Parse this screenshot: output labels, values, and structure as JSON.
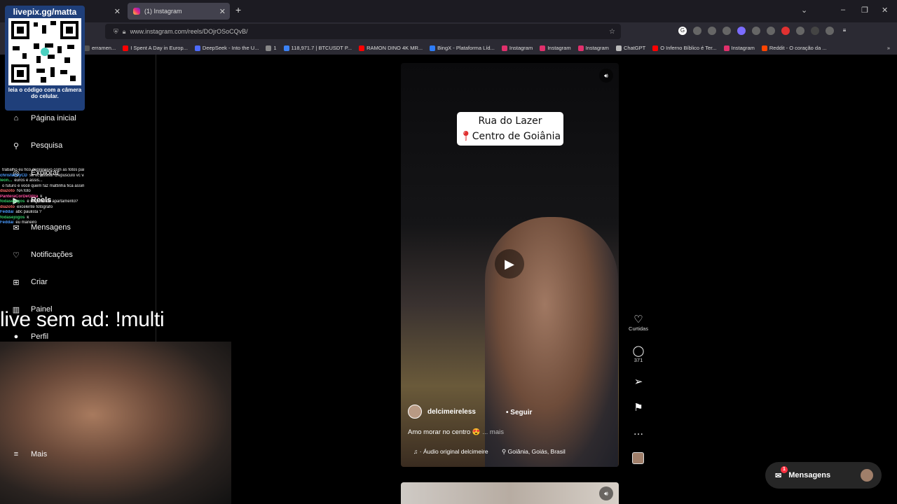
{
  "browser": {
    "tabs": [
      {
        "label": "",
        "active": false
      },
      {
        "label": "(1) Instagram",
        "active": true
      }
    ],
    "url": "www.instagram.com/reels/DOjrOSoCQvB/",
    "bookmarks": [
      {
        "label": "erramen...",
        "color": "#555555"
      },
      {
        "label": "I Spent A Day in Europ...",
        "color": "#ff0000"
      },
      {
        "label": "DeepSeek - Into the U...",
        "color": "#4d6bfe"
      },
      {
        "label": "1",
        "color": "#888888"
      },
      {
        "label": "118,971.7 | BTCUSDT P...",
        "color": "#3b82f6"
      },
      {
        "label": "RAMON DINO 4K MR...",
        "color": "#ff0000"
      },
      {
        "label": "BingX - Plataforma Líd...",
        "color": "#2e7cf6"
      },
      {
        "label": "Instagram",
        "color": "#e1306c"
      },
      {
        "label": "Instagram",
        "color": "#e1306c"
      },
      {
        "label": "Instagram",
        "color": "#e1306c"
      },
      {
        "label": "ChatGPT",
        "color": "#bbbbbb"
      },
      {
        "label": "O Inferno Bíblico é Ter...",
        "color": "#ff0000"
      },
      {
        "label": "Instagram",
        "color": "#e1306c"
      },
      {
        "label": "Reddit - O coração da ...",
        "color": "#ff4500"
      }
    ]
  },
  "overlay": {
    "qr_title": "livepix.gg/matta",
    "qr_caption": "leia o código com a câmera do celular.",
    "promo": "live sem ad: !multi",
    "chat": [
      {
        "user": "",
        "text": "trabalho eu fico depressivo com as fotos parada",
        "color": "#ffffff"
      },
      {
        "user": "chrisfarleyCD",
        "text": "se vc assistir crepusculo vc vai discar 188",
        "color": "#4a9cff"
      },
      {
        "user": "leon...",
        "text": "euros e assis...",
        "color": "#33cc66"
      },
      {
        "user": "",
        "text": "o futuro é você quem faz mattinha fica assim n",
        "color": "#8a6cff"
      },
      {
        "user": "diazoto",
        "text": "NA foto",
        "color": "#ff6a6a"
      },
      {
        "user": "PanteraCorDeG0za",
        "text": "k",
        "color": "#ff4fa0"
      },
      {
        "user": "fodasejogos",
        "text": "é negocio de apartamento?",
        "color": "#33cc66"
      },
      {
        "user": "diazoto",
        "text": "excelente fotógrafo",
        "color": "#ff6a6a"
      },
      {
        "user": "Feddai",
        "text": "abc paulista ?",
        "color": "#4a9cff"
      },
      {
        "user": "fodasejogos",
        "text": "k",
        "color": "#33cc66"
      },
      {
        "user": "Feddai",
        "text": "eu maneiro",
        "color": "#4a9cff"
      }
    ]
  },
  "sidebar": {
    "items": [
      {
        "label": "Página inicial",
        "icon": "home-icon",
        "glyph": "⌂"
      },
      {
        "label": "Pesquisa",
        "icon": "search-icon",
        "glyph": "⚲"
      },
      {
        "label": "Explorar",
        "icon": "explore-icon",
        "glyph": "◎"
      },
      {
        "label": "Reels",
        "icon": "reels-icon",
        "glyph": "▶"
      },
      {
        "label": "Mensagens",
        "icon": "messenger-icon",
        "glyph": "✉"
      },
      {
        "label": "Notificações",
        "icon": "heart-icon",
        "glyph": "♡"
      },
      {
        "label": "Criar",
        "icon": "plus-icon",
        "glyph": "⊞"
      },
      {
        "label": "Painel",
        "icon": "dashboard-icon",
        "glyph": "▥"
      },
      {
        "label": "Perfil",
        "icon": "profile-icon",
        "glyph": "●"
      }
    ],
    "more_label": "Mais"
  },
  "reel": {
    "title_line1": "Rua do Lazer",
    "title_line2": "Centro de Goiânia",
    "author": "delcimeireless",
    "follow_label": "Seguir",
    "caption": "Amo morar no centro 😍",
    "more_label": "... mais",
    "audio": "· Áudio original  delcimeire",
    "location": "Goiânia, Goiás, Brasil"
  },
  "rail": {
    "likes_label": "Curtidas",
    "comments_count": "371"
  },
  "messages_pill": {
    "label": "Mensagens",
    "badge": "1"
  }
}
